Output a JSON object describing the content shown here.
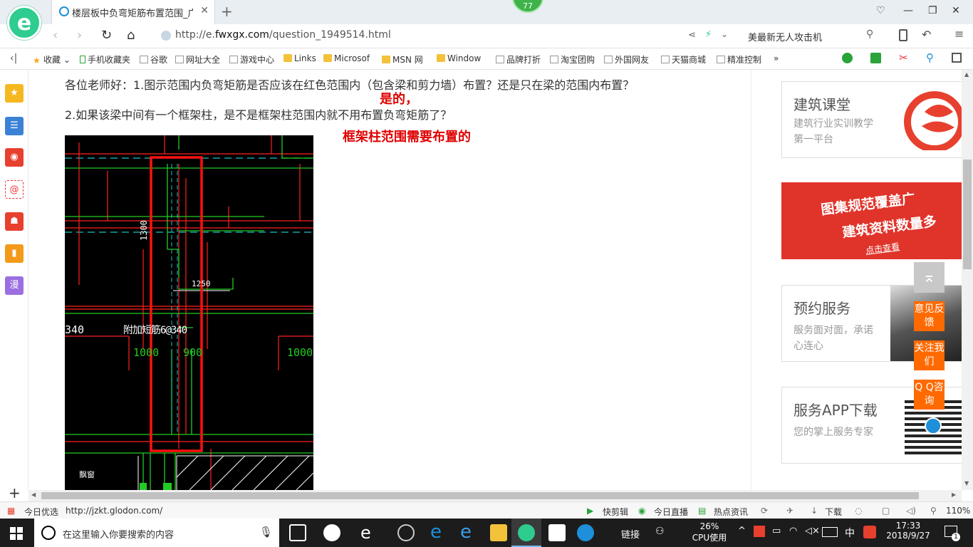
{
  "browser": {
    "logo_letter": "e",
    "tab_title": "楼层板中负弯矩筋布置范围_广联",
    "notification_count": "77",
    "url_prefix": "http://e.",
    "url_domain": "fwxgx.com",
    "url_path": "/question_1949514.html",
    "search_text": "美最新无人攻击机"
  },
  "bookmarks": [
    {
      "label": "收藏",
      "icon": "star-icon"
    },
    {
      "label": "手机收藏夹",
      "icon": "phone-icon"
    },
    {
      "label": "谷歌",
      "icon": "page-icon"
    },
    {
      "label": "网址大全",
      "icon": "page-icon"
    },
    {
      "label": "游戏中心",
      "icon": "page-icon"
    },
    {
      "label": "Links",
      "icon": "folder-icon"
    },
    {
      "label": "Microsof",
      "icon": "folder-icon"
    },
    {
      "label": "MSN 网",
      "icon": "folder-icon"
    },
    {
      "label": "Window",
      "icon": "folder-icon"
    },
    {
      "label": "品牌打折",
      "icon": "page-icon"
    },
    {
      "label": "淘宝团购",
      "icon": "page-icon"
    },
    {
      "label": "外国网友",
      "icon": "page-icon"
    },
    {
      "label": "天猫商城",
      "icon": "page-icon"
    },
    {
      "label": "精准控制",
      "icon": "page-icon"
    }
  ],
  "content": {
    "question1": "各位老师好：1.图示范围内负弯矩筋是否应该在红色范围内（包含梁和剪力墙）布置？还是只在梁的范围内布置？",
    "answer1": "是的，",
    "question2": "2.如果该梁中间有一个框架柱，是不是框架柱范围内就不用布置负弯矩筋了？",
    "answer2": "框架柱范围需要布置的"
  },
  "cad": {
    "dim_1300": "1300",
    "dim_1250": "1250",
    "label_340": "340",
    "label_bar": "附加短筋6@340",
    "dim_1000_a": "1000",
    "dim_900": "900",
    "dim_1000_b": "1000",
    "label_bottom": "飘窗"
  },
  "sidebar_ads": [
    {
      "title": "建筑课堂",
      "sub": "建筑行业实训教学第一平台"
    },
    {
      "promo1": "图集规范覆盖广",
      "promo2": "建筑资料数量多",
      "promo3": "点击查看"
    },
    {
      "title": "预约服务",
      "sub": "服务面对面，承诺心连心"
    },
    {
      "title": "服务APP下载",
      "sub": "您的掌上服务专家"
    }
  ],
  "float_buttons": {
    "feedback": "意见反馈",
    "follow": "关注我们",
    "qq": "Q Q咨询"
  },
  "status_bar": {
    "today_pick": "今日优选",
    "link_url": "http://jzkt.glodon.com/",
    "kuaijianji": "快剪辑",
    "live": "今日直播",
    "news": "热点资讯",
    "download": "下载",
    "zoom": "110%"
  },
  "taskbar": {
    "search_placeholder": "在这里输入你要搜索的内容",
    "link_label": "链接",
    "cpu_percent": "26%",
    "cpu_label": "CPU使用",
    "ime": "中",
    "time": "17:33",
    "date": "2018/9/27",
    "notif_count": "1"
  },
  "colors": {
    "accent_green": "#2ecc8f",
    "answer_red": "#e00000",
    "float_orange": "#ff6a00",
    "cad_red": "#ff2020",
    "cad_green": "#22cc22",
    "cad_cyan": "#19c2c2"
  }
}
